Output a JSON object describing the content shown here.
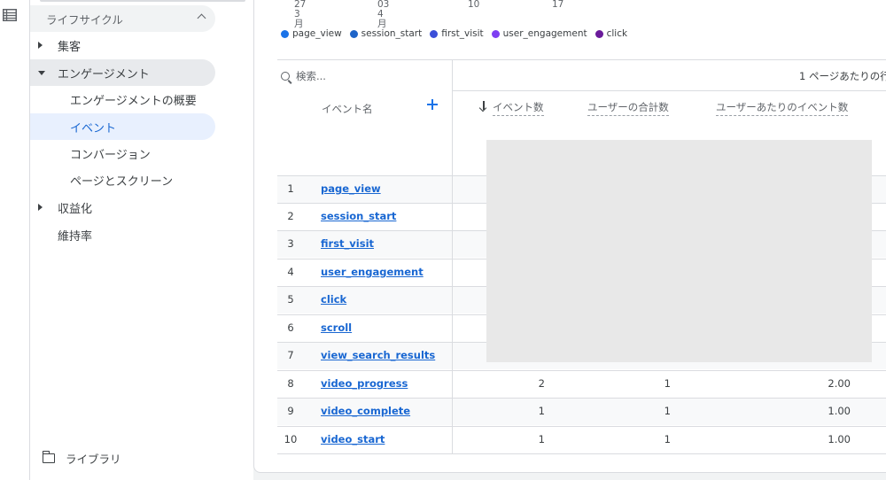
{
  "sidebar": {
    "lifecycle_label": "ライフサイクル",
    "items": [
      {
        "label": "集客"
      },
      {
        "label": "エンゲージメント"
      },
      {
        "label": "エンゲージメントの概要"
      },
      {
        "label": "イベント"
      },
      {
        "label": "コンバージョン"
      },
      {
        "label": "ページとスクリーン"
      },
      {
        "label": "収益化"
      },
      {
        "label": "維持率"
      }
    ],
    "library_label": "ライブラリ"
  },
  "chart": {
    "xticks": [
      {
        "day": "27",
        "month": "3月"
      },
      {
        "day": "03",
        "month": "4月"
      },
      {
        "day": "10",
        "month": ""
      },
      {
        "day": "17",
        "month": ""
      }
    ],
    "legend": [
      {
        "label": "page_view",
        "color": "#1a73e8"
      },
      {
        "label": "session_start",
        "color": "#1e64c8"
      },
      {
        "label": "first_visit",
        "color": "#3b4fd8"
      },
      {
        "label": "user_engagement",
        "color": "#7e3ff2"
      },
      {
        "label": "click",
        "color": "#6a1b9a"
      }
    ]
  },
  "table": {
    "search_placeholder": "検索...",
    "rows_per_page_label": "1 ページあたりの行",
    "headers": {
      "event_name": "イベント名",
      "event_count": "イベント数",
      "total_users": "ユーザーの合計数",
      "events_per_user": "ユーザーあたりのイベント数"
    },
    "rows": [
      {
        "idx": "1",
        "name": "page_view",
        "count": "",
        "users": "",
        "per_user": ""
      },
      {
        "idx": "2",
        "name": "session_start",
        "count": "",
        "users": "",
        "per_user": ""
      },
      {
        "idx": "3",
        "name": "first_visit",
        "count": "",
        "users": "",
        "per_user": ""
      },
      {
        "idx": "4",
        "name": "user_engagement",
        "count": "",
        "users": "",
        "per_user": ""
      },
      {
        "idx": "5",
        "name": "click",
        "count": "",
        "users": "",
        "per_user": ""
      },
      {
        "idx": "6",
        "name": "scroll",
        "count": "",
        "users": "",
        "per_user": ""
      },
      {
        "idx": "7",
        "name": "view_search_results",
        "count": "",
        "users": "",
        "per_user": ""
      },
      {
        "idx": "8",
        "name": "video_progress",
        "count": "2",
        "users": "1",
        "per_user": "2.00"
      },
      {
        "idx": "9",
        "name": "video_complete",
        "count": "1",
        "users": "1",
        "per_user": "1.00"
      },
      {
        "idx": "10",
        "name": "video_start",
        "count": "1",
        "users": "1",
        "per_user": "1.00"
      }
    ]
  }
}
